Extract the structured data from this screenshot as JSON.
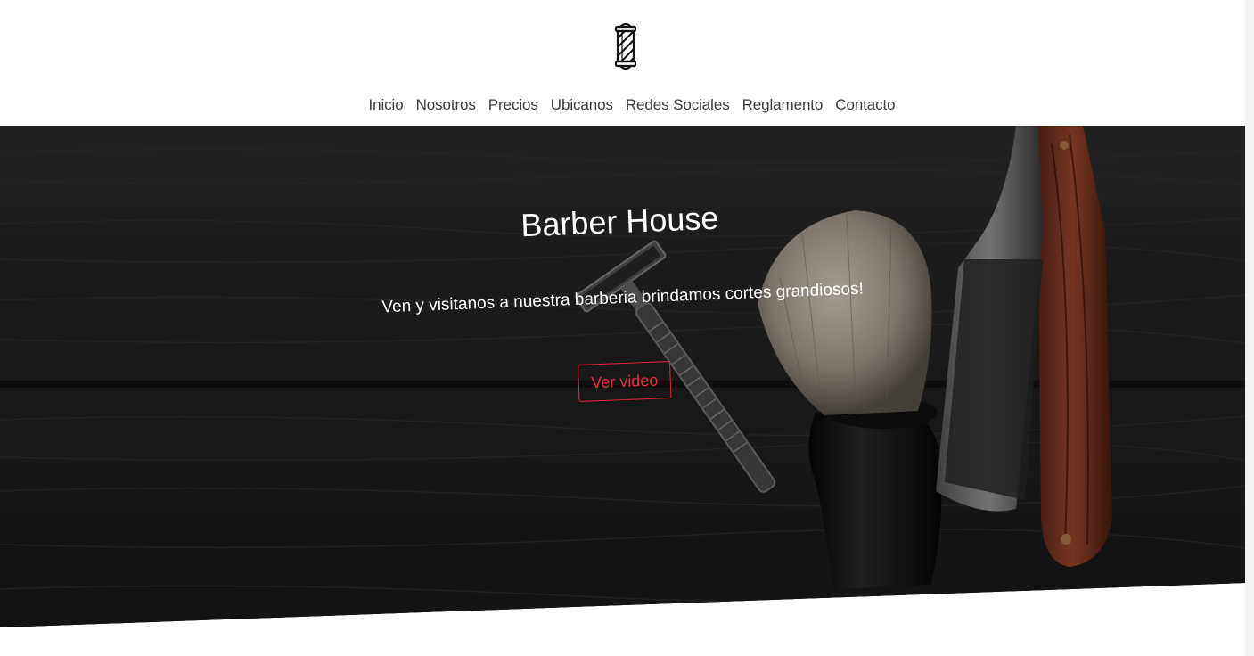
{
  "header": {
    "logo_icon": "barber-pole-icon"
  },
  "nav": {
    "items": [
      {
        "label": "Inicio"
      },
      {
        "label": "Nosotros"
      },
      {
        "label": "Precios"
      },
      {
        "label": "Ubicanos"
      },
      {
        "label": "Redes Sociales"
      },
      {
        "label": "Reglamento"
      },
      {
        "label": "Contacto"
      }
    ]
  },
  "hero": {
    "title": "Barber House",
    "subtitle": "Ven y visitanos a nuestra barberia brindamos cortes grandiosos!",
    "button_label": "Ver video",
    "accent_color": "#e0283a",
    "background_icon": "shaving-tools-photo"
  }
}
